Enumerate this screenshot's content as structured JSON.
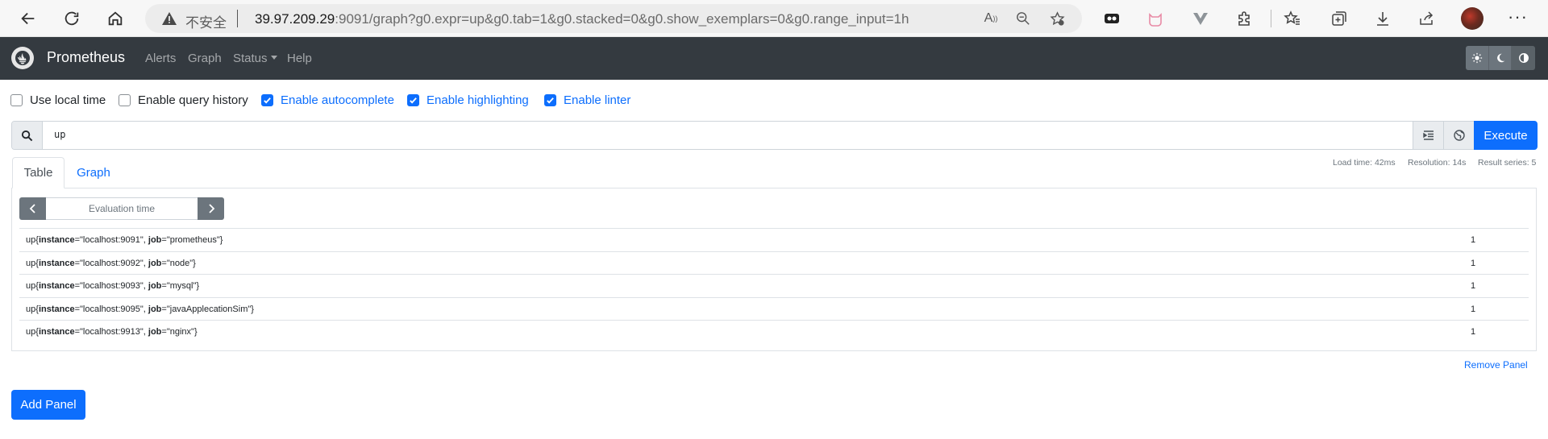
{
  "browser": {
    "insecure_label": "不安全",
    "url_host": "39.97.209.29",
    "url_rest": ":9091/graph?g0.expr=up&g0.tab=1&g0.stacked=0&g0.show_exemplars=0&g0.range_input=1h"
  },
  "navbar": {
    "brand": "Prometheus",
    "links": [
      "Alerts",
      "Graph",
      "Status",
      "Help"
    ]
  },
  "options": [
    {
      "label": "Use local time",
      "checked": false
    },
    {
      "label": "Enable query history",
      "checked": false
    },
    {
      "label": "Enable autocomplete",
      "checked": true
    },
    {
      "label": "Enable highlighting",
      "checked": true
    },
    {
      "label": "Enable linter",
      "checked": true
    }
  ],
  "query": {
    "expression": "up",
    "execute_label": "Execute",
    "stats": {
      "load_time": "Load time: 42ms",
      "resolution": "Resolution: 14s",
      "result_series": "Result series: 5"
    }
  },
  "panel": {
    "tabs": [
      "Table",
      "Graph"
    ],
    "active_tab": "Table",
    "eval_placeholder": "Evaluation time",
    "rows": [
      {
        "metric": "up",
        "instance": "localhost:9091",
        "job": "prometheus",
        "value": "1"
      },
      {
        "metric": "up",
        "instance": "localhost:9092",
        "job": "node",
        "value": "1"
      },
      {
        "metric": "up",
        "instance": "localhost:9093",
        "job": "mysql",
        "value": "1"
      },
      {
        "metric": "up",
        "instance": "localhost:9095",
        "job": "javaApplecationSim",
        "value": "1"
      },
      {
        "metric": "up",
        "instance": "localhost:9913",
        "job": "nginx",
        "value": "1"
      }
    ],
    "remove_label": "Remove Panel"
  },
  "add_panel_label": "Add Panel",
  "colors": {
    "navbar": "#343a40",
    "primary": "#0d6efd",
    "secondary": "#6c757d"
  }
}
